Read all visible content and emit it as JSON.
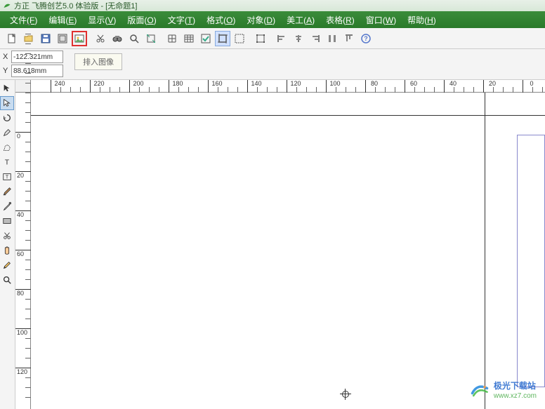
{
  "title": "方正 飞腾创艺5.0 体验版 - [无命题1]",
  "menu": [
    {
      "label": "文件",
      "key": "F"
    },
    {
      "label": "编辑",
      "key": "E"
    },
    {
      "label": "显示",
      "key": "V"
    },
    {
      "label": "版面",
      "key": "O"
    },
    {
      "label": "文字",
      "key": "T"
    },
    {
      "label": "格式",
      "key": "O"
    },
    {
      "label": "对象",
      "key": "D"
    },
    {
      "label": "美工",
      "key": "A"
    },
    {
      "label": "表格",
      "key": "R"
    },
    {
      "label": "窗口",
      "key": "W"
    },
    {
      "label": "帮助",
      "key": "H"
    }
  ],
  "toolbar_icons": [
    {
      "name": "new-doc-icon"
    },
    {
      "name": "open-icon"
    },
    {
      "name": "save-icon"
    },
    {
      "name": "import-frame-icon"
    },
    {
      "name": "insert-image-icon",
      "highlight": true
    },
    {
      "name": "cut-icon"
    },
    {
      "name": "binoculars-icon"
    },
    {
      "name": "magnifier-icon"
    },
    {
      "name": "transform-icon"
    },
    {
      "name": "grid-icon"
    },
    {
      "name": "table-icon"
    },
    {
      "name": "check-icon"
    },
    {
      "name": "crop-icon",
      "active": true
    },
    {
      "name": "selection-icon"
    },
    {
      "name": "bounds-icon"
    },
    {
      "name": "align-left-icon"
    },
    {
      "name": "align-center-icon"
    },
    {
      "name": "align-right-icon"
    },
    {
      "name": "distribute-icon"
    },
    {
      "name": "align-top-icon"
    },
    {
      "name": "help-icon"
    }
  ],
  "coords": {
    "x_label": "X",
    "y_label": "Y",
    "x_value": "-122.321mm",
    "y_value": "88.618mm"
  },
  "tooltip": "排入图像",
  "ruler_h_ticks": [
    240,
    220,
    200,
    180,
    160,
    140,
    120,
    100,
    80,
    60,
    40,
    20,
    0
  ],
  "ruler_v_ticks": [
    0,
    20,
    40,
    60,
    80,
    100,
    120
  ],
  "palette": [
    {
      "name": "pointer-tool",
      "selected": false
    },
    {
      "name": "direct-select-tool",
      "selected": true
    },
    {
      "name": "rotate-tool"
    },
    {
      "name": "pen-tool"
    },
    {
      "name": "polygon-tool"
    },
    {
      "name": "text-tool"
    },
    {
      "name": "text-frame-tool"
    },
    {
      "name": "brush-tool"
    },
    {
      "name": "eyedropper-tool"
    },
    {
      "name": "rectangle-tool"
    },
    {
      "name": "scissors-tool"
    },
    {
      "name": "hand-tool"
    },
    {
      "name": "pencil-tool"
    },
    {
      "name": "zoom-tool"
    }
  ],
  "watermark": {
    "cn": "极光下载站",
    "url": "www.xz7.com"
  }
}
